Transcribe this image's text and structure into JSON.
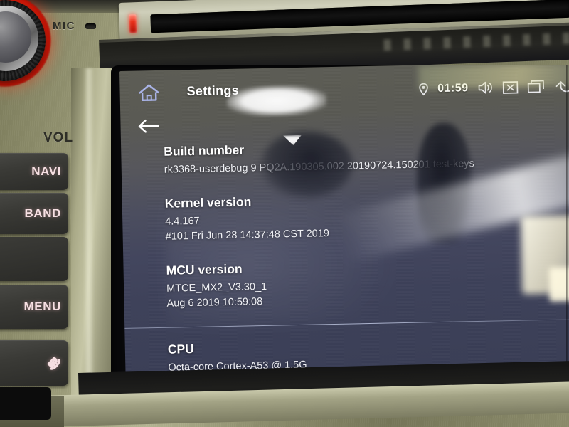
{
  "device": {
    "brand_labels": {
      "mic": "MIC",
      "vol": "VOL"
    },
    "buttons": [
      {
        "name": "navi",
        "label": "NAVI"
      },
      {
        "name": "band",
        "label": "BAND"
      },
      {
        "name": "menu",
        "label": "MENU"
      },
      {
        "name": "hangup",
        "label": "⌕",
        "icon": "phone-hangup-icon"
      }
    ]
  },
  "screen": {
    "statusbar": {
      "home_icon": "home-icon",
      "back_icon": "back-arrow-icon",
      "title": "Settings",
      "location_icon": "location-pin-icon",
      "time": "01:59",
      "volume_icon": "speaker-volume-icon",
      "close_icon": "close-box-icon",
      "recents_icon": "recent-apps-icon",
      "back_nav_icon": "back-nav-icon"
    },
    "settings": {
      "rows": [
        {
          "title": "Build number",
          "lines": [
            "rk3368-userdebug 9 PQ2A.190305.002 20190724.150201 test-keys"
          ]
        },
        {
          "title": "Kernel version",
          "lines": [
            "4.4.167",
            "#101 Fri Jun 28 14:37:48 CST 2019"
          ]
        },
        {
          "title": "MCU version",
          "lines": [
            "MTCE_MX2_V3.30_1",
            "Aug  6 2019 10:59:08"
          ]
        },
        {
          "title": "CPU",
          "lines": [
            "Octa-core Cortex-A53 @  1.5G"
          ]
        }
      ]
    }
  },
  "colors": {
    "bezel": "#8f8f6e",
    "screen_top": "#5b5b53",
    "screen_bottom": "#383c54",
    "led_red": "#e8301a",
    "button_label": "#f6dfe2",
    "home_icon": "#aab4e8",
    "text": "#ffffff"
  }
}
